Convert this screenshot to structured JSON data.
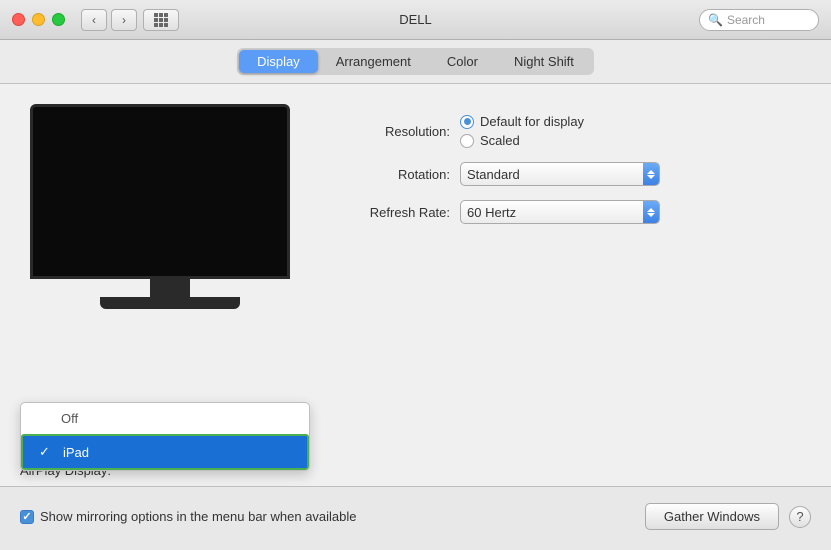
{
  "titlebar": {
    "title": "DELL",
    "search_placeholder": "Search"
  },
  "tabs": {
    "items": [
      "Display",
      "Arrangement",
      "Color",
      "Night Shift"
    ],
    "active": 0
  },
  "display": {
    "resolution_label": "Resolution:",
    "resolution_options": [
      {
        "label": "Default for display",
        "selected": true
      },
      {
        "label": "Scaled",
        "selected": false
      }
    ],
    "rotation_label": "Rotation:",
    "rotation_value": "Standard",
    "refresh_label": "Refresh Rate:",
    "refresh_value": "60 Hertz"
  },
  "airplay": {
    "label": "AirPlay Display:",
    "dropdown_items": [
      {
        "label": "Off",
        "selected": false
      },
      {
        "label": "iPad",
        "selected": true
      }
    ]
  },
  "bottom": {
    "checkbox_label": "Show mirroring options in the menu bar when available",
    "gather_btn": "Gather Windows",
    "help_btn": "?"
  },
  "icons": {
    "back": "‹",
    "forward": "›",
    "search": "🔍"
  }
}
